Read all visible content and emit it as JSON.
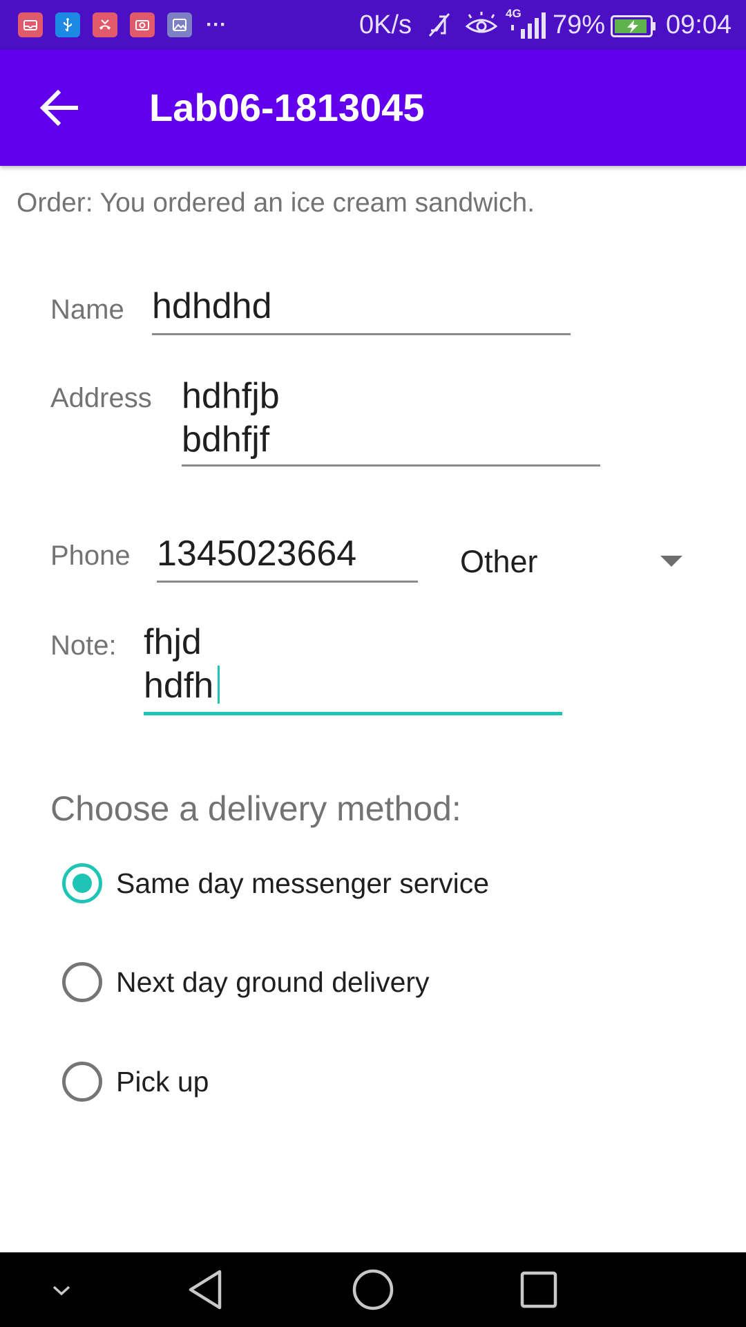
{
  "status_bar": {
    "notification_icons": [
      "mail-icon",
      "usb-icon",
      "missed-call-icon",
      "video-icon",
      "gallery-icon"
    ],
    "more_indicator": "···",
    "network_speed": "0K/s",
    "network_type": "4G",
    "battery_percent": "79%",
    "time": "09:04"
  },
  "app_bar": {
    "title": "Lab06-1813045"
  },
  "order_summary": "Order: You ordered an ice cream sandwich.",
  "form": {
    "name_label": "Name",
    "name_value": "hdhdhd",
    "address_label": "Address",
    "address_value": "hdhfjb\nbdhfjf",
    "phone_label": "Phone",
    "phone_value": "1345023664",
    "phone_type_selected": "Other",
    "note_label": "Note:",
    "note_value": "fhjd\nhdfh"
  },
  "delivery": {
    "heading": "Choose a delivery method:",
    "options": [
      {
        "label": "Same day messenger service",
        "checked": true
      },
      {
        "label": "Next day ground delivery",
        "checked": false
      },
      {
        "label": "Pick up",
        "checked": false
      }
    ]
  },
  "colors": {
    "status_bar": "#4b10c4",
    "app_bar": "#6200ee",
    "accent": "#1ec5b5"
  }
}
